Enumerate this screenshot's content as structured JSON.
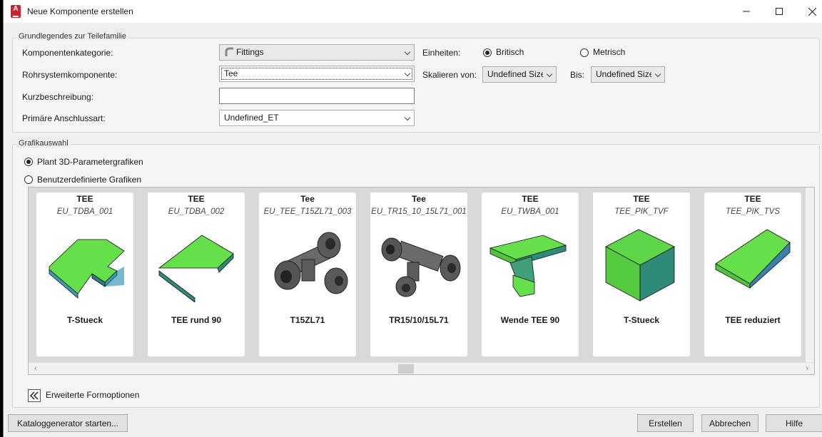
{
  "window": {
    "title": "Neue Komponente erstellen",
    "app_icon": "autocad-plant-icon"
  },
  "grundlegend": {
    "label": "Grundlegendes zur Teilefamilie",
    "komponentenkategorie": {
      "label": "Komponentenkategorie:",
      "value": "Fittings"
    },
    "rohrsystemkomponente": {
      "label": "Rohrsystemkomponente:",
      "value": "Tee"
    },
    "kurzbeschreibung": {
      "label": "Kurzbeschreibung:",
      "value": ""
    },
    "anschlussart": {
      "label": "Primäre Anschlussart:",
      "value": "Undefined_ET"
    },
    "einheiten": {
      "label": "Einheiten:",
      "britisch": "Britisch",
      "metrisch": "Metrisch",
      "selected": "Britisch"
    },
    "skalieren": {
      "label": "Skalieren von:",
      "value": "Undefined Size"
    },
    "bis": {
      "label": "Bis:",
      "value": "Undefined Size"
    }
  },
  "grafik": {
    "label": "Grafikauswahl",
    "option_plant": "Plant 3D-Parametergrafiken",
    "option_benutzer": "Benutzerdefinierte Grafiken",
    "selected": "plant",
    "cards": [
      {
        "title": "TEE",
        "sub": "EU_TDBA_001",
        "name": "T-Stueck"
      },
      {
        "title": "TEE",
        "sub": "EU_TDBA_002",
        "name": "TEE rund 90"
      },
      {
        "title": "Tee",
        "sub": "EU_TEE_T15ZL71_003",
        "name": "T15ZL71"
      },
      {
        "title": "Tee",
        "sub": "EU_TR15_10_15L71_001",
        "name": "TR15/10/15L71"
      },
      {
        "title": "TEE",
        "sub": "EU_TWBA_001",
        "name": "Wende TEE 90"
      },
      {
        "title": "TEE",
        "sub": "TEE_PIK_TVF",
        "name": "T-Stueck"
      },
      {
        "title": "TEE",
        "sub": "TEE_PIK_TVS",
        "name": "TEE reduziert"
      }
    ]
  },
  "erweitert": "Erweiterte Formoptionen",
  "buttons": {
    "katalog": "Kataloggenerator starten...",
    "erstellen": "Erstellen",
    "abbrechen": "Abbrechen",
    "hilfe": "Hilfe"
  },
  "colors": {
    "shape_green": "#66e04a",
    "shape_side": "#2e8b7a",
    "fitting_grey": "#5a5a5a"
  }
}
